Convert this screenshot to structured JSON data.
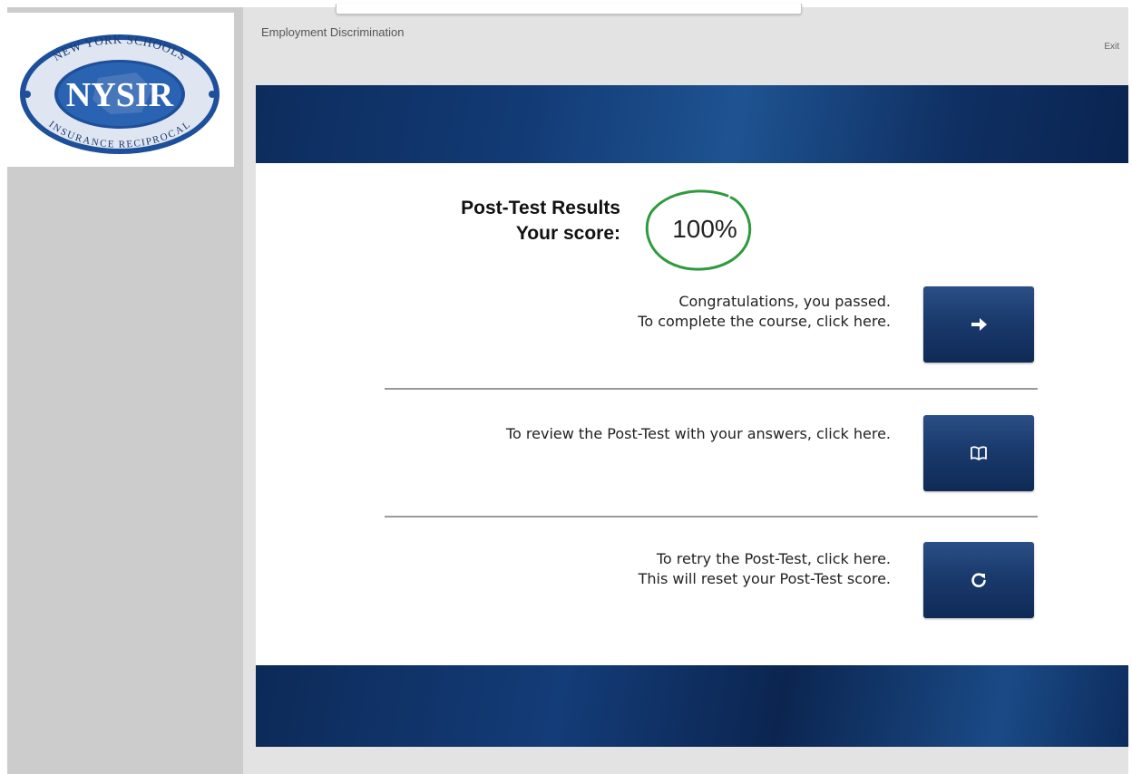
{
  "sidebar": {
    "logo": {
      "icon": "nysir-logo",
      "top_text": "NEW YORK SCHOOLS",
      "center_text": "NYSIR",
      "bottom_text": "INSURANCE RECIPROCAL"
    }
  },
  "header": {
    "course_title": "Employment Discrimination",
    "exit_label": "Exit"
  },
  "results": {
    "heading_line1": "Post-Test Results",
    "heading_line2": "Your score:",
    "score": "100%"
  },
  "actions": [
    {
      "line1": "Congratulations, you passed.",
      "line2": "To complete the course, click here.",
      "icon": "arrow-right-icon"
    },
    {
      "line1": "To review the Post-Test with your answers, click here.",
      "line2": "",
      "icon": "book-icon"
    },
    {
      "line1": "To retry the Post-Test, click here.",
      "line2": "This will reset your Post-Test score.",
      "icon": "refresh-icon"
    }
  ],
  "colors": {
    "button_blue": "#1a3a6d",
    "banner_blue": "#123a74",
    "score_circle_green": "#2e9a3e"
  }
}
